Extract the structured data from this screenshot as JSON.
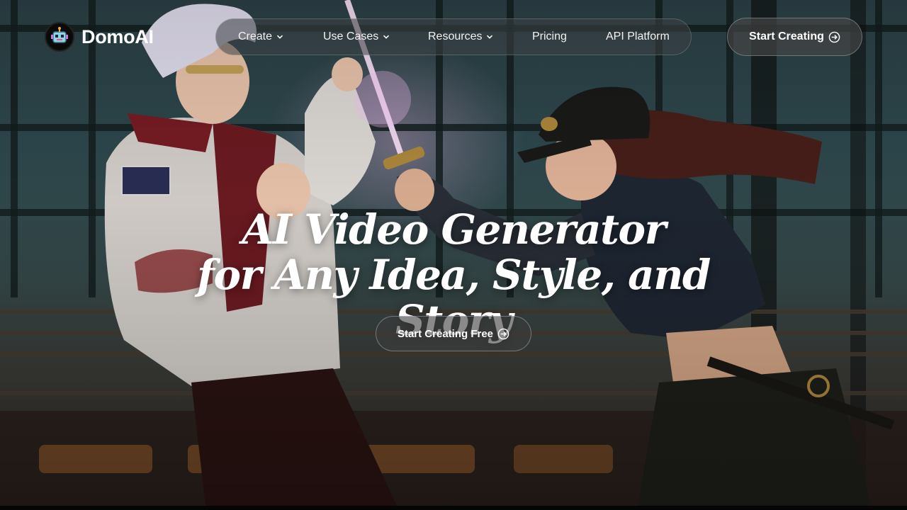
{
  "brand": {
    "name": "DomoAI",
    "logo_icon": "robot-icon"
  },
  "nav": {
    "items": [
      {
        "label": "Create",
        "has_dropdown": true
      },
      {
        "label": "Use Cases",
        "has_dropdown": true
      },
      {
        "label": "Resources",
        "has_dropdown": true
      },
      {
        "label": "Pricing",
        "has_dropdown": false
      },
      {
        "label": "API Platform",
        "has_dropdown": false
      }
    ]
  },
  "header_cta": {
    "label": "Start Creating",
    "icon": "arrow-right-circle-icon"
  },
  "hero": {
    "headline_line1": "AI Video Generator",
    "headline_line2": "for Any Idea, Style, and Story",
    "cta_label": "Start Creating Free",
    "cta_icon": "arrow-right-circle-icon"
  },
  "colors": {
    "text": "#ffffff",
    "nav_bg": "#3c4246",
    "button_bg": "#464646"
  }
}
